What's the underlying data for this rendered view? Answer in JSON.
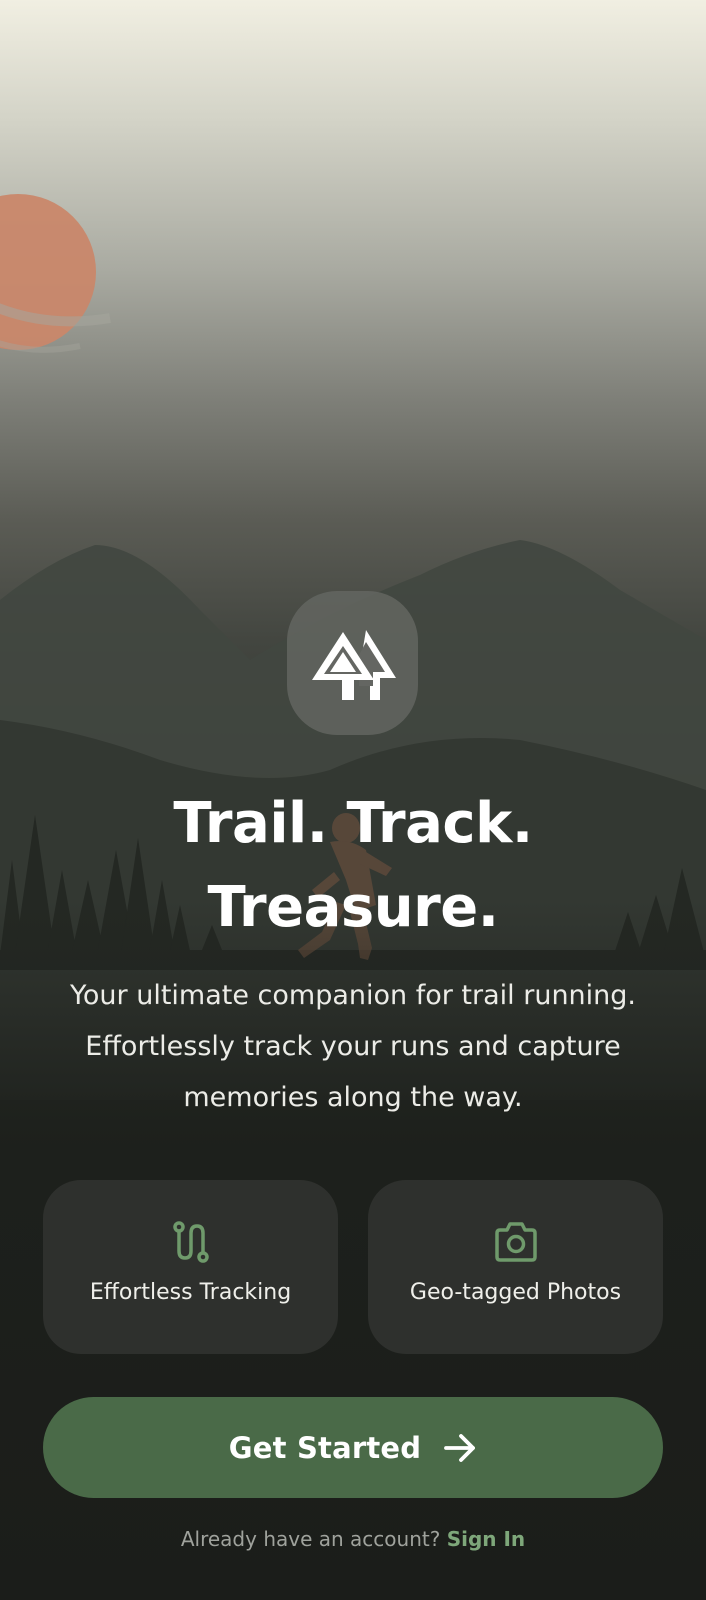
{
  "hero": {
    "title_line1": "Trail. Track.",
    "title_line2": "Treasure.",
    "description_line1": "Your ultimate companion for trail running.",
    "description_line2": "Effortlessly track your runs and capture",
    "description_line3": "memories along the way.",
    "logo_icon": "pine-trees-icon"
  },
  "features": [
    {
      "label": "Effortless Tracking",
      "icon": "route-icon"
    },
    {
      "label": "Geo-tagged Photos",
      "icon": "camera-icon"
    }
  ],
  "cta": {
    "label": "Get Started",
    "icon": "arrow-right-icon"
  },
  "signin": {
    "prompt": "Already have an account?",
    "link_label": "Sign In"
  },
  "colors": {
    "accent": "#4a6a48",
    "accent_light": "#6f9a6b",
    "link": "#7ea77a",
    "card_bg": "#2e302d",
    "page_bg": "#1b1d1a",
    "sun": "#c9876a"
  }
}
